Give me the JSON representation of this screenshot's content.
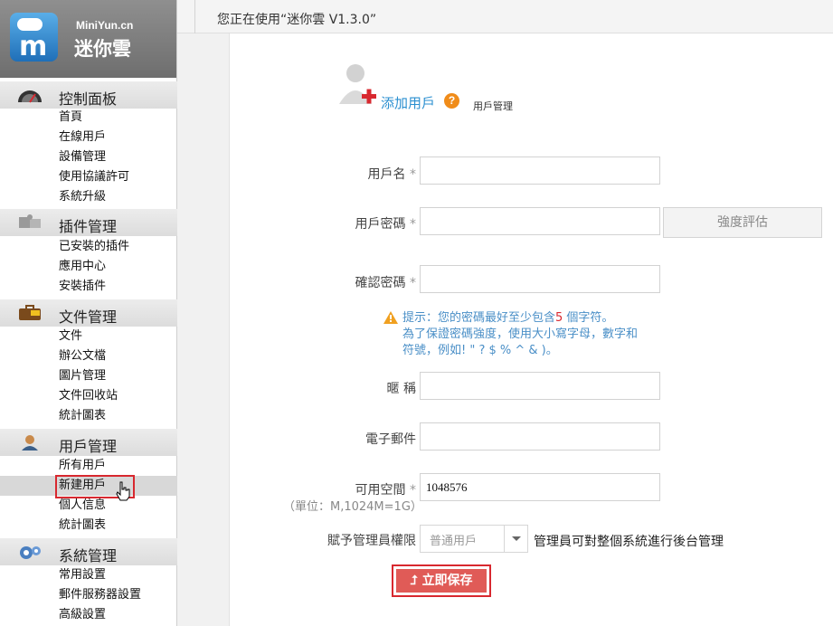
{
  "brand": {
    "site": "MiniYun.cn",
    "name": "迷你雲"
  },
  "header": {
    "status": "您正在使用“迷你雲 V1.3.0”"
  },
  "sidebar": {
    "sections": [
      {
        "title": "控制面板",
        "icon": "dashboard-icon",
        "items": [
          "首頁",
          "在線用戶",
          "設備管理",
          "使用協議許可",
          "系統升級"
        ]
      },
      {
        "title": "插件管理",
        "icon": "puzzle-icon",
        "items": [
          "已安裝的插件",
          "應用中心",
          "安裝插件"
        ]
      },
      {
        "title": "文件管理",
        "icon": "briefcase-icon",
        "items": [
          "文件",
          "辦公文檔",
          "圖片管理",
          "文件回收站",
          "統計圖表"
        ]
      },
      {
        "title": "用戶管理",
        "icon": "user-icon",
        "items": [
          "所有用戶",
          "新建用戶",
          "個人信息",
          "統計圖表"
        ]
      },
      {
        "title": "系統管理",
        "icon": "gear-icon",
        "items": [
          "常用設置",
          "郵件服務器設置",
          "高級設置"
        ]
      }
    ],
    "active_item": "新建用戶"
  },
  "page": {
    "title": "添加用戶",
    "breadcrumb": "用戶管理"
  },
  "form": {
    "username_label": "用戶名",
    "password_label": "用戶密碼",
    "confirm_label": "確認密碼",
    "strength_button": "強度評估",
    "tip_prefix": "提示：您的密碼最好至少包含",
    "tip_number": "5",
    "tip_suffix": " 個字符。",
    "tip_line2": "為了保證密碼強度，使用大小寫字母，數字和符號，例如! \" ? $ % ^ & )。",
    "nickname_label": "暱 稱",
    "email_label": "電子郵件",
    "space_label": "可用空間",
    "space_value": "1048576",
    "unit_note": "（單位：M,1024M=1G）",
    "required_mark": "*",
    "admin_label": "賦予管理員權限",
    "admin_select_value": "普通用戶",
    "admin_note": "管理員可對整個系統進行後台管理",
    "save_button": "立即保存"
  },
  "colors": {
    "accent": "#2b8fd0",
    "save": "#e05b57",
    "highlight": "#d8282f"
  }
}
